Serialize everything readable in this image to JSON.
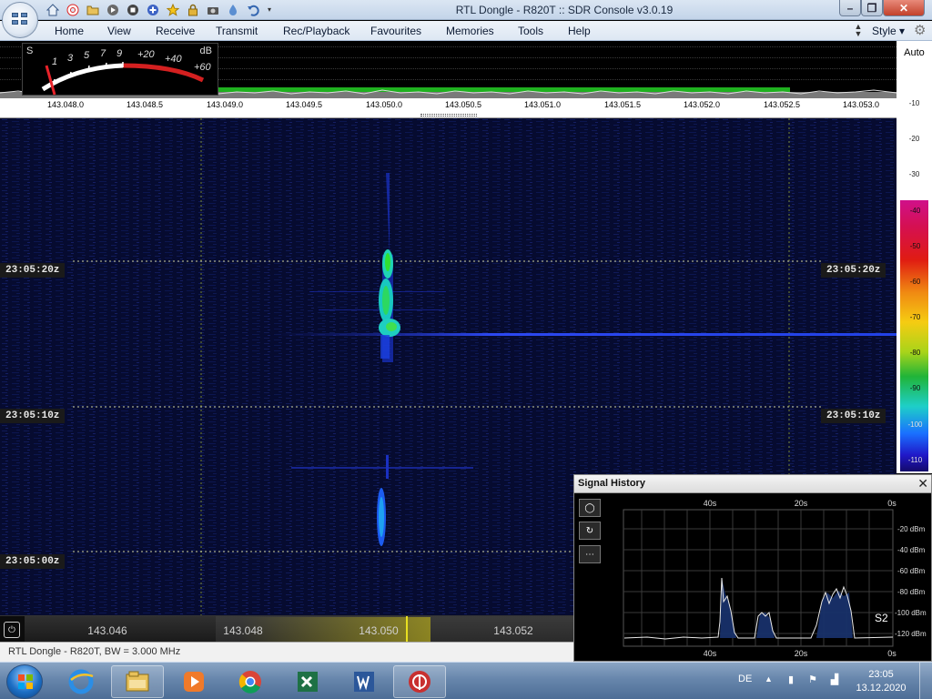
{
  "window": {
    "title": "RTL Dongle - R820T :: SDR Console v3.0.19",
    "min_icon": "minimize-icon",
    "max_icon": "maximize-icon",
    "close_icon": "close-icon"
  },
  "qat": [
    "home-icon",
    "lifebuoy-icon",
    "folder-icon",
    "play-icon",
    "stop-icon",
    "plus-icon",
    "star-icon",
    "lock-icon",
    "camera-icon",
    "drop-icon",
    "undo-icon",
    "dropdown-icon"
  ],
  "ribbon": {
    "tabs": [
      "Home",
      "View",
      "Receive",
      "Transmit",
      "Rec/Playback",
      "Favourites",
      "Memories",
      "Tools",
      "Help"
    ],
    "style_label": "Style"
  },
  "smeter": {
    "s_label": "S",
    "db_label": "dB",
    "scale": [
      "1",
      "3",
      "5",
      "7",
      "9",
      "+20",
      "+40",
      "+60"
    ]
  },
  "freq_scale": [
    "143.048.0",
    "143.048.5",
    "143.049.0",
    "143.049.5",
    "143.050.0",
    "143.050.5",
    "143.051.0",
    "143.051.5",
    "143.052.0",
    "143.052.5",
    "143.053.0"
  ],
  "db_scale": {
    "auto": "Auto",
    "labels": [
      "-10",
      "-20",
      "-30",
      "-40",
      "-50",
      "-60",
      "-70",
      "-80",
      "-90",
      "-100",
      "-110"
    ]
  },
  "waterfall": {
    "time_tags": [
      "23:05:20z",
      "23:05:10z",
      "23:05:00z"
    ]
  },
  "tuner": {
    "labels": [
      "143.046",
      "143.048",
      "143.050",
      "143.052"
    ]
  },
  "status": {
    "text": "RTL Dongle - R820T, BW = 3.000 MHz"
  },
  "signal_history": {
    "title": "Signal History",
    "buttons": [
      "circle-icon",
      "refresh-icon",
      "more-icon"
    ],
    "time_labels": [
      "40s",
      "20s",
      "0s"
    ],
    "dbm_labels": [
      "-20 dBm",
      "-40 dBm",
      "-60 dBm",
      "-80 dBm",
      "-100 dBm",
      "-120 dBm"
    ],
    "s_reading": "S2"
  },
  "taskbar": {
    "apps": [
      "ie-icon",
      "explorer-icon",
      "media-player-icon",
      "chrome-icon",
      "excel-icon",
      "word-icon",
      "sdr-console-icon"
    ],
    "lang": "DE",
    "time": "23:05",
    "date": "13.12.2020"
  }
}
